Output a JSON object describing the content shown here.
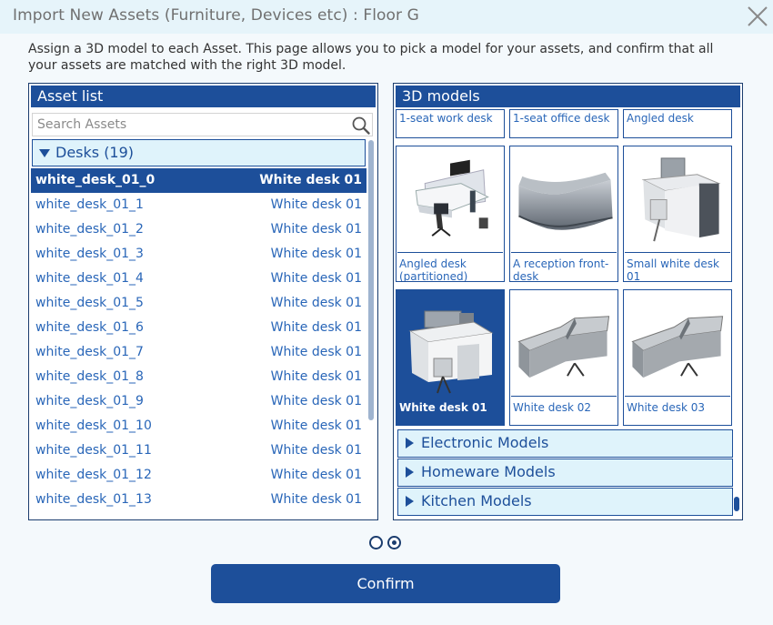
{
  "window": {
    "title": "Import New Assets (Furniture, Devices etc) : Floor G"
  },
  "description": "Assign a 3D model to each Asset. This page allows you to pick a model for your assets, and confirm that all your assets are matched with the right 3D model.",
  "asset_panel": {
    "header": "Asset list",
    "search_placeholder": "Search Assets",
    "group_label": "Desks (19)",
    "rows": [
      {
        "name": "white_desk_01_0",
        "model": "White desk 01"
      },
      {
        "name": "white_desk_01_1",
        "model": "White desk 01"
      },
      {
        "name": "white_desk_01_2",
        "model": "White desk 01"
      },
      {
        "name": "white_desk_01_3",
        "model": "White desk 01"
      },
      {
        "name": "white_desk_01_4",
        "model": "White desk 01"
      },
      {
        "name": "white_desk_01_5",
        "model": "White desk 01"
      },
      {
        "name": "white_desk_01_6",
        "model": "White desk 01"
      },
      {
        "name": "white_desk_01_7",
        "model": "White desk 01"
      },
      {
        "name": "white_desk_01_8",
        "model": "White desk 01"
      },
      {
        "name": "white_desk_01_9",
        "model": "White desk 01"
      },
      {
        "name": "white_desk_01_10",
        "model": "White desk 01"
      },
      {
        "name": "white_desk_01_11",
        "model": "White desk 01"
      },
      {
        "name": "white_desk_01_12",
        "model": "White desk 01"
      },
      {
        "name": "white_desk_01_13",
        "model": "White desk 01"
      }
    ]
  },
  "models_panel": {
    "header": "3D models",
    "models": [
      {
        "label": "1-seat work desk"
      },
      {
        "label": "1-seat office desk"
      },
      {
        "label": "Angled desk"
      },
      {
        "label": "Angled desk (partitioned)"
      },
      {
        "label": "A reception front-desk"
      },
      {
        "label": "Small white desk 01"
      },
      {
        "label": "White desk 01"
      },
      {
        "label": "White desk 02"
      },
      {
        "label": "White desk 03"
      }
    ],
    "groups": [
      {
        "label": "Electronic Models"
      },
      {
        "label": "Homeware Models"
      },
      {
        "label": "Kitchen Models"
      }
    ]
  },
  "pager": {
    "pages": 2,
    "current": 2
  },
  "confirm_label": "Confirm",
  "colors": {
    "accent": "#1d4f9a",
    "light_fill": "#dff3fb",
    "link_text": "#2966b8"
  }
}
